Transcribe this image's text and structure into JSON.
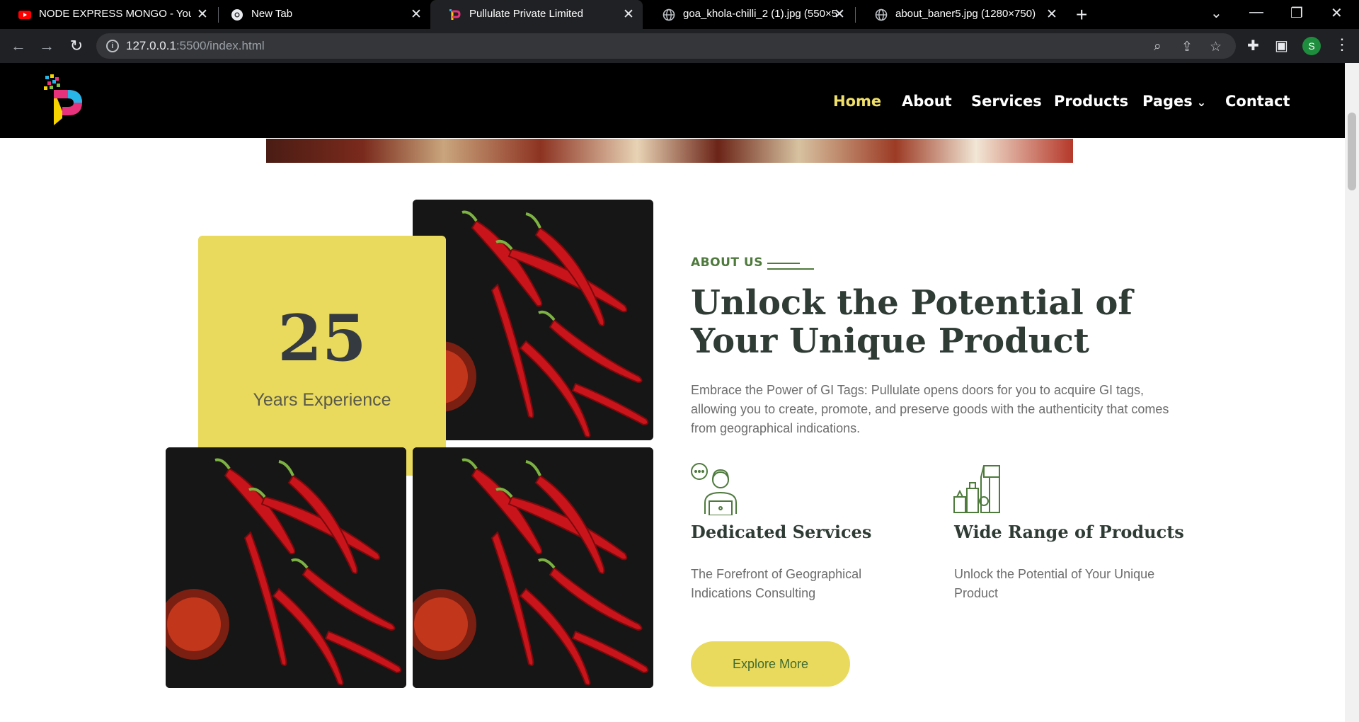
{
  "browser": {
    "tabs": [
      {
        "title": "NODE EXPRESS MONGO - YouTu",
        "icon": "youtube-icon"
      },
      {
        "title": "New Tab",
        "icon": "chrome-icon"
      },
      {
        "title": "Pullulate Private Limited",
        "icon": "pullulate-favicon"
      },
      {
        "title": "goa_khola-chilli_2 (1).jpg (550×5",
        "icon": "globe-icon"
      },
      {
        "title": "about_baner5.jpg (1280×750)",
        "icon": "globe-icon"
      }
    ],
    "url_host": "127.0.0.1",
    "url_rest": ":5500/index.html",
    "profile_initial": "S"
  },
  "site": {
    "nav": [
      {
        "label": "Home"
      },
      {
        "label": "About"
      },
      {
        "label": "Services"
      },
      {
        "label": "Products"
      },
      {
        "label": "Pages"
      },
      {
        "label": "Contact"
      }
    ]
  },
  "about": {
    "experience_number": "25",
    "experience_label": "Years Experience",
    "kicker": "ABOUT US",
    "title": "Unlock the Potential of Your Unique Product",
    "description": "Embrace the Power of GI Tags: Pullulate opens doors for you to acquire GI tags, allowing you to create, promote, and preserve goods with the authenticity that comes from geographical indications.",
    "features": [
      {
        "title": "Dedicated Services",
        "desc": "The Forefront of Geographical Indications Consulting",
        "icon": "support-agent-icon"
      },
      {
        "title": "Wide Range of Products",
        "desc": "Unlock the Potential of Your Unique Product",
        "icon": "products-icon"
      }
    ],
    "button_label": "Explore More"
  },
  "colors": {
    "accent_yellow": "#e9da5e",
    "nav_active": "#f0e06a",
    "brand_green": "#4e7a3c",
    "heading": "#2f3b35"
  }
}
